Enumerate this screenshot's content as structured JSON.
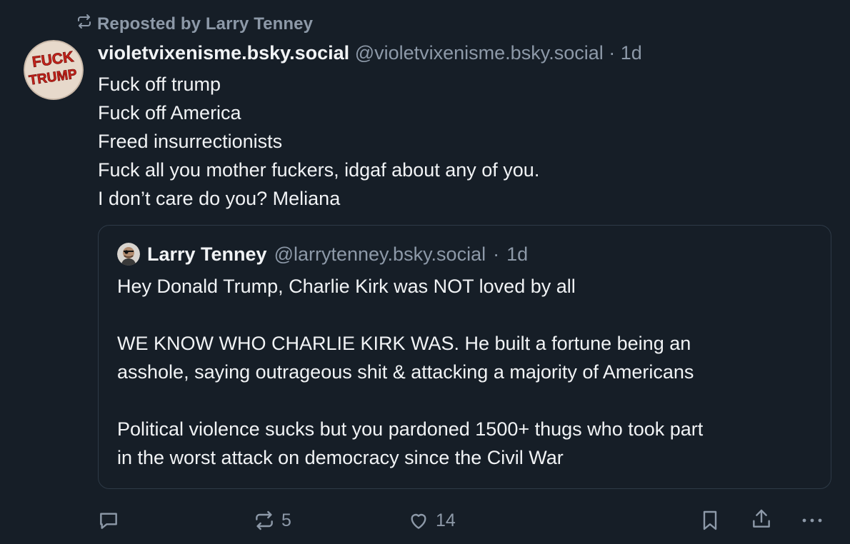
{
  "repost": {
    "label": "Reposted by Larry Tenney"
  },
  "post": {
    "display_name": "violetvixenisme.bsky.social",
    "handle": "@violetvixenisme.bsky.social",
    "separator": "·",
    "time": "1d",
    "avatar_text_top": "FUCK",
    "avatar_text_bottom": "TRUMP",
    "lines": [
      "Fuck off trump",
      "Fuck off America",
      "Freed insurrectionists",
      "Fuck all you mother fuckers, idgaf about any of you.",
      "I don’t care do you? Meliana"
    ]
  },
  "quote": {
    "display_name": "Larry Tenney",
    "handle": "@larrytenney.bsky.social",
    "separator": "·",
    "time": "1d",
    "paragraphs": [
      [
        "Hey Donald Trump, Charlie Kirk was NOT loved by all"
      ],
      [
        "WE KNOW WHO CHARLIE KIRK WAS. He built a fortune being an",
        "asshole, saying outrageous shit & attacking a majority of Americans"
      ],
      [
        "Political violence sucks but you pardoned 1500+ thugs who took part",
        "in the worst attack on democracy since the Civil War"
      ]
    ]
  },
  "actions": {
    "reply_icon": "reply-icon",
    "repost_icon": "repost-icon",
    "repost_count": "5",
    "like_icon": "heart-icon",
    "like_count": "14",
    "bookmark_icon": "bookmark-icon",
    "share_icon": "share-icon",
    "more_icon": "more-icon"
  },
  "colors": {
    "background": "#161e27",
    "text": "#f1f3f5",
    "muted": "#8d99a8",
    "border": "#2e3a47"
  }
}
